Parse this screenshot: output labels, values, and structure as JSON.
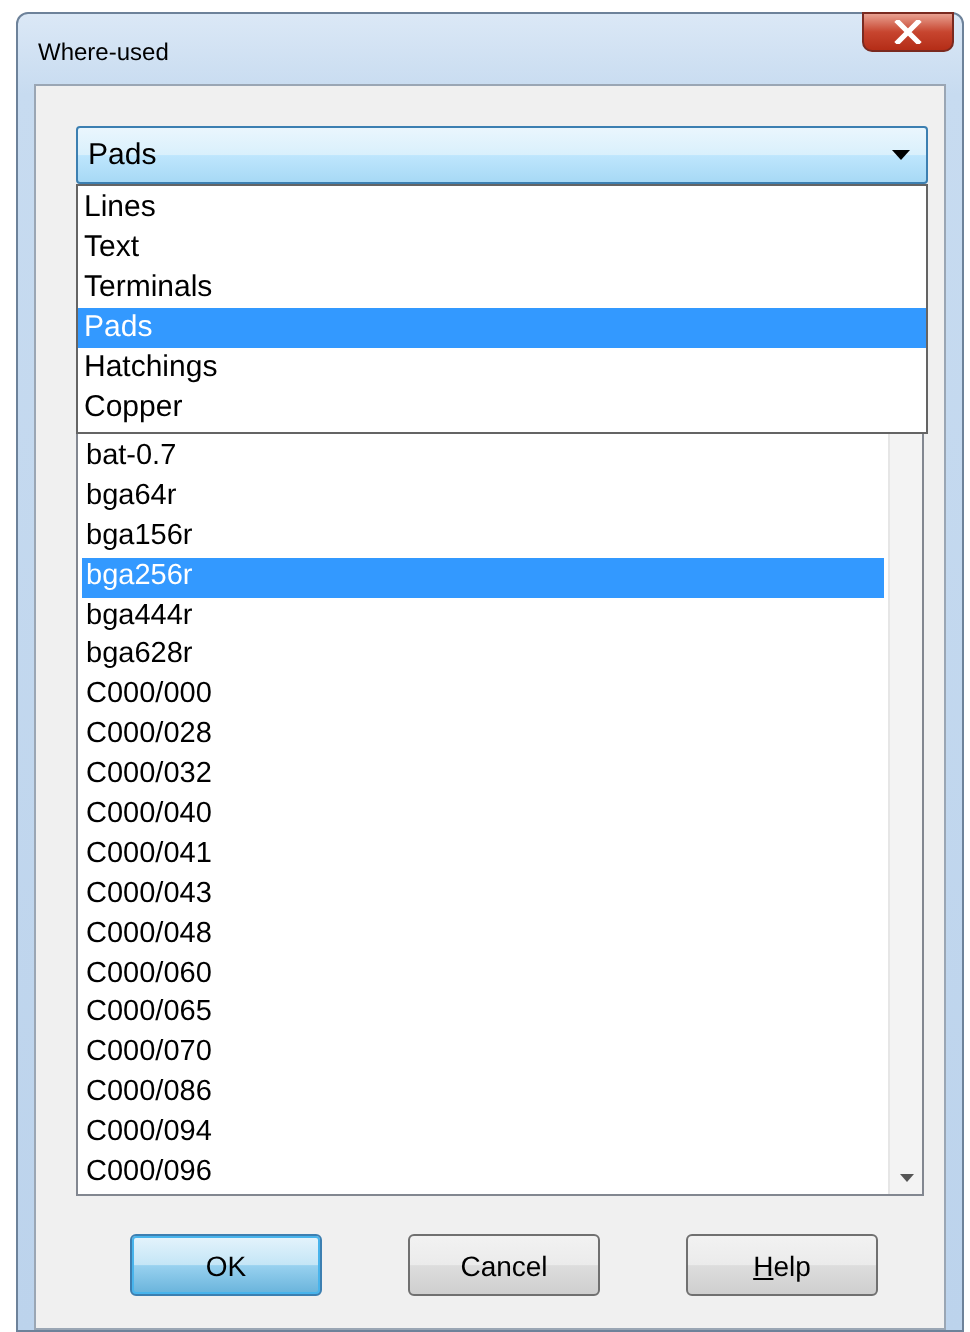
{
  "window": {
    "title": "Where-used"
  },
  "combo": {
    "value": "Pads",
    "expanded": true,
    "options": [
      {
        "label": "Lines",
        "selected": false
      },
      {
        "label": "Text",
        "selected": false
      },
      {
        "label": "Terminals",
        "selected": false
      },
      {
        "label": "Pads",
        "selected": true
      },
      {
        "label": "Hatchings",
        "selected": false
      },
      {
        "label": "Copper",
        "selected": false
      }
    ]
  },
  "list": {
    "items": [
      {
        "label": "bat-0.7",
        "selected": false
      },
      {
        "label": "bga64r",
        "selected": false
      },
      {
        "label": "bga156r",
        "selected": false
      },
      {
        "label": "bga256r",
        "selected": true
      },
      {
        "label": "bga444r",
        "selected": false
      },
      {
        "label": "bga628r",
        "selected": false
      },
      {
        "label": "C000/000",
        "selected": false
      },
      {
        "label": "C000/028",
        "selected": false
      },
      {
        "label": "C000/032",
        "selected": false
      },
      {
        "label": "C000/040",
        "selected": false
      },
      {
        "label": "C000/041",
        "selected": false
      },
      {
        "label": "C000/043",
        "selected": false
      },
      {
        "label": "C000/048",
        "selected": false
      },
      {
        "label": "C000/060",
        "selected": false
      },
      {
        "label": "C000/065",
        "selected": false
      },
      {
        "label": "C000/070",
        "selected": false
      },
      {
        "label": "C000/086",
        "selected": false
      },
      {
        "label": "C000/094",
        "selected": false
      },
      {
        "label": "C000/096",
        "selected": false
      }
    ]
  },
  "buttons": [
    {
      "label": "OK",
      "focused": true,
      "mnemonic": false
    },
    {
      "label": "Cancel",
      "focused": false,
      "mnemonic": false
    },
    {
      "label": "Help",
      "focused": false,
      "mnemonic": true
    }
  ]
}
